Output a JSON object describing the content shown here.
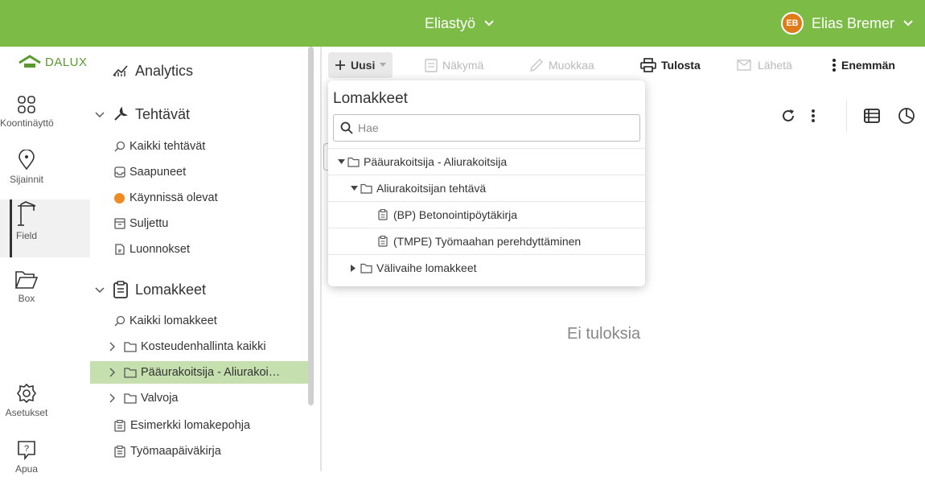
{
  "topbar": {
    "project": "Eliastyö",
    "user_initials": "EB",
    "user_name": "Elias Bremer"
  },
  "brand": "DALUX",
  "rail": [
    {
      "label": "Koontinäyttö"
    },
    {
      "label": "Sijainnit"
    },
    {
      "label": "Field"
    },
    {
      "label": "Box"
    },
    {
      "label": "Asetukset"
    },
    {
      "label": "Apua"
    }
  ],
  "tree": {
    "analytics": "Analytics",
    "tasks_title": "Tehtävät",
    "tasks": [
      "Kaikki tehtävät",
      "Saapuneet",
      "Käynnissä olevat",
      "Suljettu",
      "Luonnokset"
    ],
    "forms_title": "Lomakkeet",
    "forms": [
      "Kaikki lomakkeet",
      "Kosteudenhallinta kaikki",
      "Pääurakoitsija - Aliurakoi…",
      "Valvoja",
      "Esimerkki lomakepohja",
      "Työmaapäiväkirja"
    ]
  },
  "toolbar": {
    "new": "Uusi",
    "view": "Näkymä",
    "edit": "Muokkaa",
    "print": "Tulosta",
    "send": "Lähetä",
    "more": "Enemmän"
  },
  "empty_text": "Ei tuloksia",
  "dropdown": {
    "title": "Lomakkeet",
    "search_placeholder": "Hae",
    "rows": [
      "Pääurakoitsija - Aliurakoitsija",
      "Aliurakoitsijan tehtävä",
      "(BP) Betonointipöytäkirja",
      "(TMPE) Työmaahan perehdyttäminen",
      "Välivaihe lomakkeet"
    ]
  },
  "colors": {
    "brand_green": "#7cbb46",
    "selected_row": "#c5e0ae",
    "avatar": "#e07b1a",
    "in_progress_dot": "#f08a24"
  }
}
